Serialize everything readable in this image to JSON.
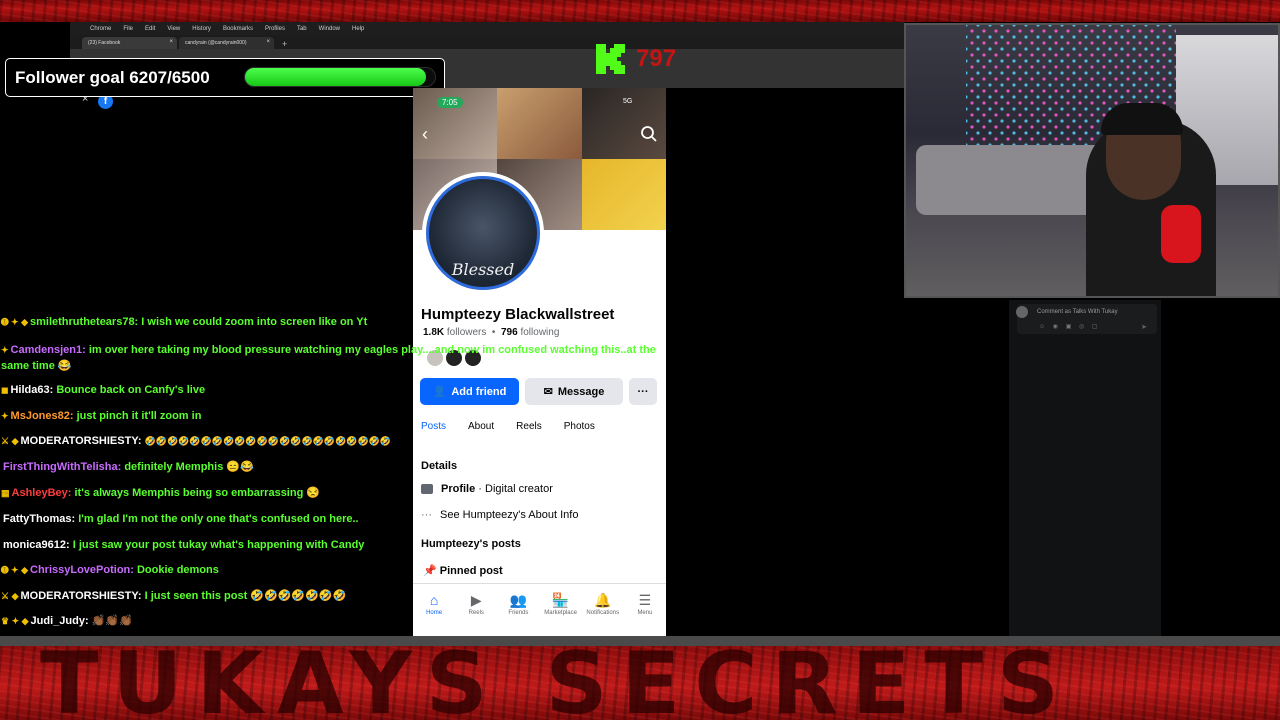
{
  "browser": {
    "menu": [
      "Chrome",
      "File",
      "Edit",
      "View",
      "History",
      "Bookmarks",
      "Profiles",
      "Tab",
      "Window",
      "Help"
    ],
    "tabs": [
      {
        "label": "(23) Facebook",
        "active": true
      },
      {
        "label": "candyrain (@candyrain000)",
        "active": false
      }
    ],
    "new_tab": "+"
  },
  "goal": {
    "label": "Follower goal 6207/6500",
    "current": 6207,
    "target": 6500
  },
  "kick": {
    "viewers": "797",
    "brand_color": "#53fc18"
  },
  "phone": {
    "status_time": "7:05",
    "status_right": "5G",
    "profile_name": "Humpteezy Blackwallstreet",
    "followers_count": "1.8K",
    "followers_label": "followers",
    "following_count": "796",
    "following_label": "following",
    "avatar_caption": "Blessed",
    "add_friend": "Add friend",
    "message": "Message",
    "more": "···",
    "tabs": [
      "Posts",
      "About",
      "Reels",
      "Photos"
    ],
    "details_title": "Details",
    "detail_profile_bold": "Profile",
    "detail_profile_rest": " · Digital creator",
    "detail_about": "See Humpteezy's About Info",
    "posts_title": "Humpteezy's posts",
    "pinned": "Pinned post",
    "nav": [
      {
        "label": "Home",
        "icon": "home-icon",
        "glyph": "⌂"
      },
      {
        "label": "Reels",
        "icon": "reels-icon",
        "glyph": "▶"
      },
      {
        "label": "Friends",
        "icon": "friends-icon",
        "glyph": "👥"
      },
      {
        "label": "Marketplace",
        "icon": "marketplace-icon",
        "glyph": "🏪"
      },
      {
        "label": "Notifications",
        "icon": "bell-icon",
        "glyph": "🔔"
      },
      {
        "label": "Menu",
        "icon": "menu-icon",
        "glyph": "☰"
      }
    ],
    "accent": "#0866ff"
  },
  "chat": [
    {
      "badges": "➊ ✦ ◆",
      "user": "smilethruthetears78:",
      "color": "#59ff2e",
      "text": "I wish we could zoom into screen like on Yt"
    },
    {
      "badges": "✦",
      "user": "Camdensjen1:",
      "color": "#c86bff",
      "text": "im over here taking my blood pressure watching my eagles play....and now im confused watching this..at the same time 😂"
    },
    {
      "badges": "◼",
      "user": "Hilda63:",
      "color": "#ffffff",
      "text": "Bounce back on Canfy's live"
    },
    {
      "badges": "✦",
      "user": "MsJones82:",
      "color": "#ff9a2e",
      "text": "just pinch it it'll zoom in"
    },
    {
      "badges": "⚔ ◆",
      "user": "MODERATORSHIESTY:",
      "color": "#ffffff",
      "text": "🤣🤣🤣🤣🤣🤣🤣🤣🤣🤣🤣🤣🤣🤣🤣🤣🤣🤣🤣🤣🤣🤣"
    },
    {
      "badges": "",
      "user": "FirstThingWithTelisha:",
      "color": "#c86bff",
      "text": "definitely Memphis 😑😂"
    },
    {
      "badges": "▦",
      "user": "AshleyBey:",
      "color": "#ff3b3b",
      "text": "it's always Memphis being so embarrassing 😒"
    },
    {
      "badges": "",
      "user": "FattyThomas:",
      "color": "#ffffff",
      "text": "I'm glad I'm not the only one that's confused on here.."
    },
    {
      "badges": "",
      "user": "monica9612:",
      "color": "#ffffff",
      "text": "I just saw your post tukay what's happening with Candy"
    },
    {
      "badges": "➊ ✦ ◆",
      "user": "ChrissyLovePotion:",
      "color": "#c86bff",
      "text": "Dookie demons"
    },
    {
      "badges": "⚔ ◆",
      "user": "MODERATORSHIESTY:",
      "color": "#ffffff",
      "text": "I just seen this post 🤣🤣🤣🤣🤣🤣🤣"
    },
    {
      "badges": "♛ ✦ ◆",
      "user": "Judi_Judy:",
      "color": "#ffffff",
      "text": "👏🏾👏🏾👏🏾"
    }
  ],
  "comment_box": {
    "placeholder": "Comment as Talks With Tukay"
  },
  "bottom_banner": "TUKAYS SECRETS",
  "colors": {
    "frame_red": "#b31212",
    "chat_text": "#59ff2e",
    "goal_bar": "#2de02d"
  }
}
